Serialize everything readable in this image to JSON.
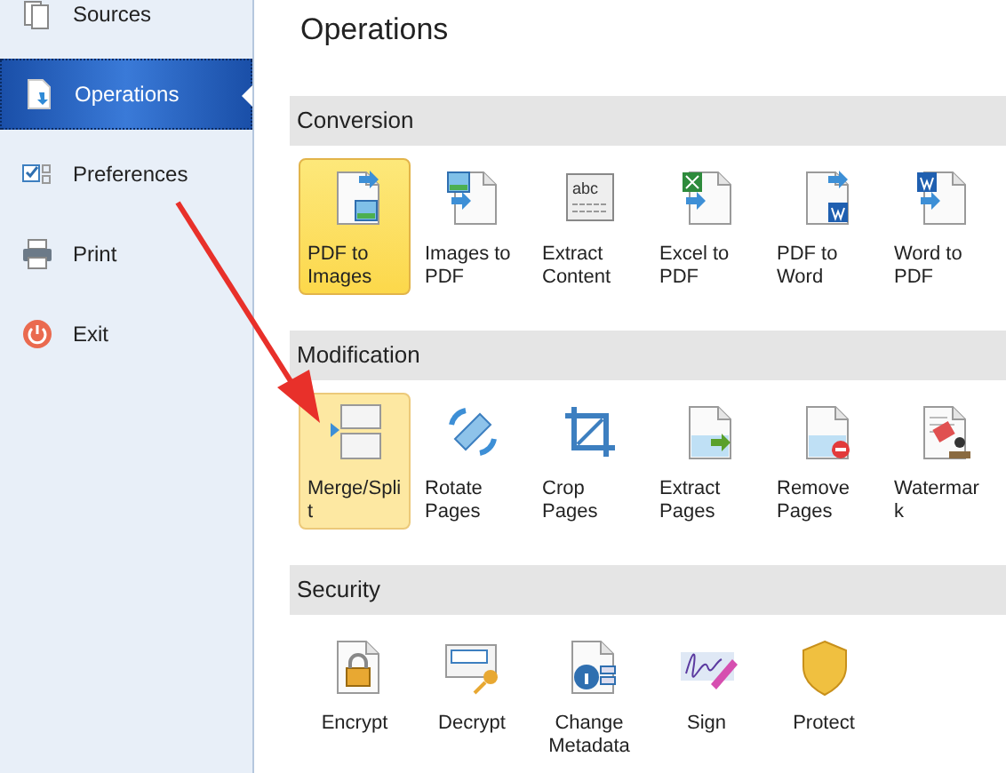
{
  "sidebar": {
    "items": [
      {
        "label": "Sources",
        "selected": false
      },
      {
        "label": "Operations",
        "selected": true
      },
      {
        "label": "Preferences",
        "selected": false
      },
      {
        "label": "Print",
        "selected": false
      },
      {
        "label": "Exit",
        "selected": false
      }
    ]
  },
  "page_title": "Operations",
  "sections": [
    {
      "title": "Conversion",
      "tools": [
        {
          "label": "PDF to Images",
          "selected": true,
          "hovered": false
        },
        {
          "label": "Images to PDF",
          "selected": false,
          "hovered": false
        },
        {
          "label": "Extract Content",
          "selected": false,
          "hovered": false,
          "icon_text": "abc"
        },
        {
          "label": "Excel to PDF",
          "selected": false,
          "hovered": false
        },
        {
          "label": "PDF to Word",
          "selected": false,
          "hovered": false
        },
        {
          "label": "Word to PDF",
          "selected": false,
          "hovered": false
        }
      ]
    },
    {
      "title": "Modification",
      "tools": [
        {
          "label": "Merge/Split",
          "selected": false,
          "hovered": true
        },
        {
          "label": "Rotate Pages",
          "selected": false,
          "hovered": false
        },
        {
          "label": "Crop Pages",
          "selected": false,
          "hovered": false
        },
        {
          "label": "Extract Pages",
          "selected": false,
          "hovered": false
        },
        {
          "label": "Remove Pages",
          "selected": false,
          "hovered": false
        },
        {
          "label": "Watermark",
          "selected": false,
          "hovered": false
        }
      ]
    },
    {
      "title": "Security",
      "tools": [
        {
          "label": "Encrypt",
          "selected": false,
          "hovered": false
        },
        {
          "label": "Decrypt",
          "selected": false,
          "hovered": false
        },
        {
          "label": "Change Metadata",
          "selected": false,
          "hovered": false
        },
        {
          "label": "Sign",
          "selected": false,
          "hovered": false
        },
        {
          "label": "Protect",
          "selected": false,
          "hovered": false
        }
      ]
    }
  ]
}
